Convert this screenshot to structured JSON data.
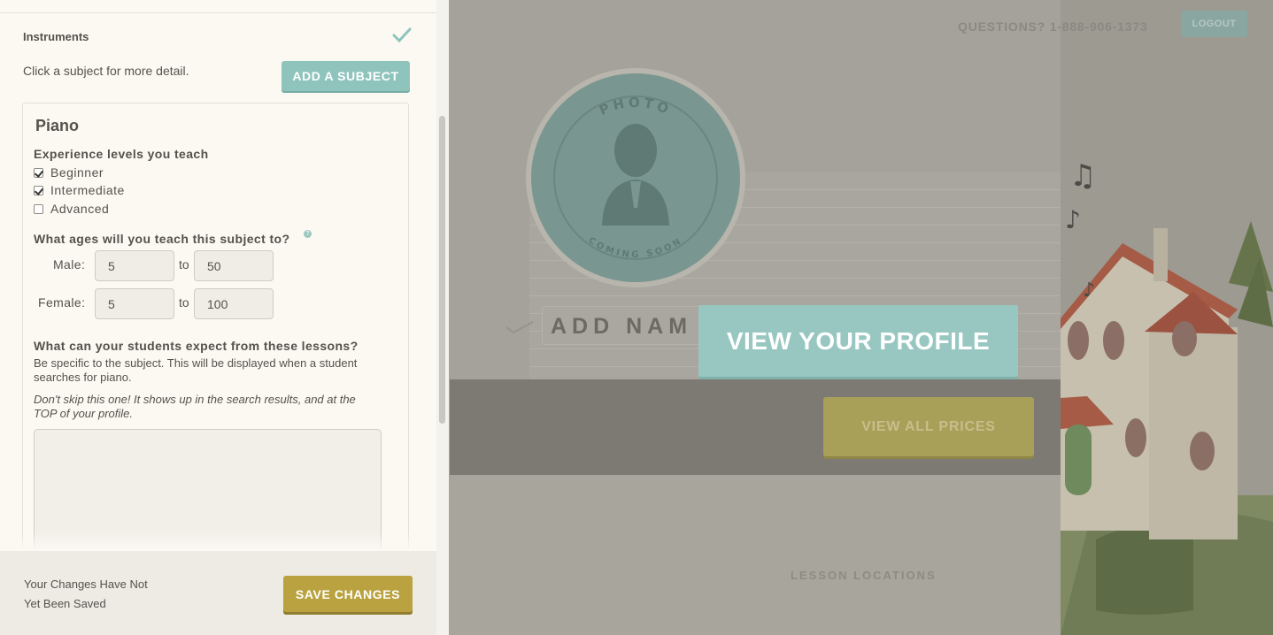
{
  "editor": {
    "section_title": "Instruments",
    "hint": "Click a subject for more detail.",
    "add_subject_label": "ADD A SUBJECT",
    "subject": {
      "name": "Piano",
      "experience_heading": "Experience levels you teach",
      "levels": [
        {
          "label": "Beginner",
          "checked": true
        },
        {
          "label": "Intermediate",
          "checked": true
        },
        {
          "label": "Advanced",
          "checked": false
        }
      ],
      "ages_heading": "What ages will you teach this subject to?",
      "help_icon": "?",
      "male_label": "Male:",
      "female_label": "Female:",
      "to_label": "to",
      "male_from": "5",
      "male_to": "50",
      "female_from": "5",
      "female_to": "100",
      "expect_heading": "What can your students expect from these lessons?",
      "expect_desc_line1": "Be specific to the subject. This will be displayed when a student",
      "expect_desc_line2": "searches for piano.",
      "expect_italic_line1": "Don't skip this one! It shows up in the search results, and at the",
      "expect_italic_line2": "TOP of your profile.",
      "lesson_text": ""
    }
  },
  "footer": {
    "unsaved_line1": "Your Changes Have Not",
    "unsaved_line2": "Yet Been Saved",
    "save_label": "SAVE CHANGES"
  },
  "preview": {
    "questions": "QUESTIONS? 1-888-906-1373",
    "logout_label": "LOGOUT",
    "photo_top_text": "PHOTO",
    "photo_bottom_text": "COMING SOON",
    "add_name_text": "ADD NAM",
    "view_profile_label": "VIEW YOUR PROFILE",
    "view_prices_label": "VIEW ALL PRICES",
    "lesson_locations": "LESSON LOCATIONS"
  },
  "colors": {
    "accent_teal": "#8fc4bd",
    "accent_gold": "#b9a23f",
    "panel_bg": "#fbf9f2"
  }
}
